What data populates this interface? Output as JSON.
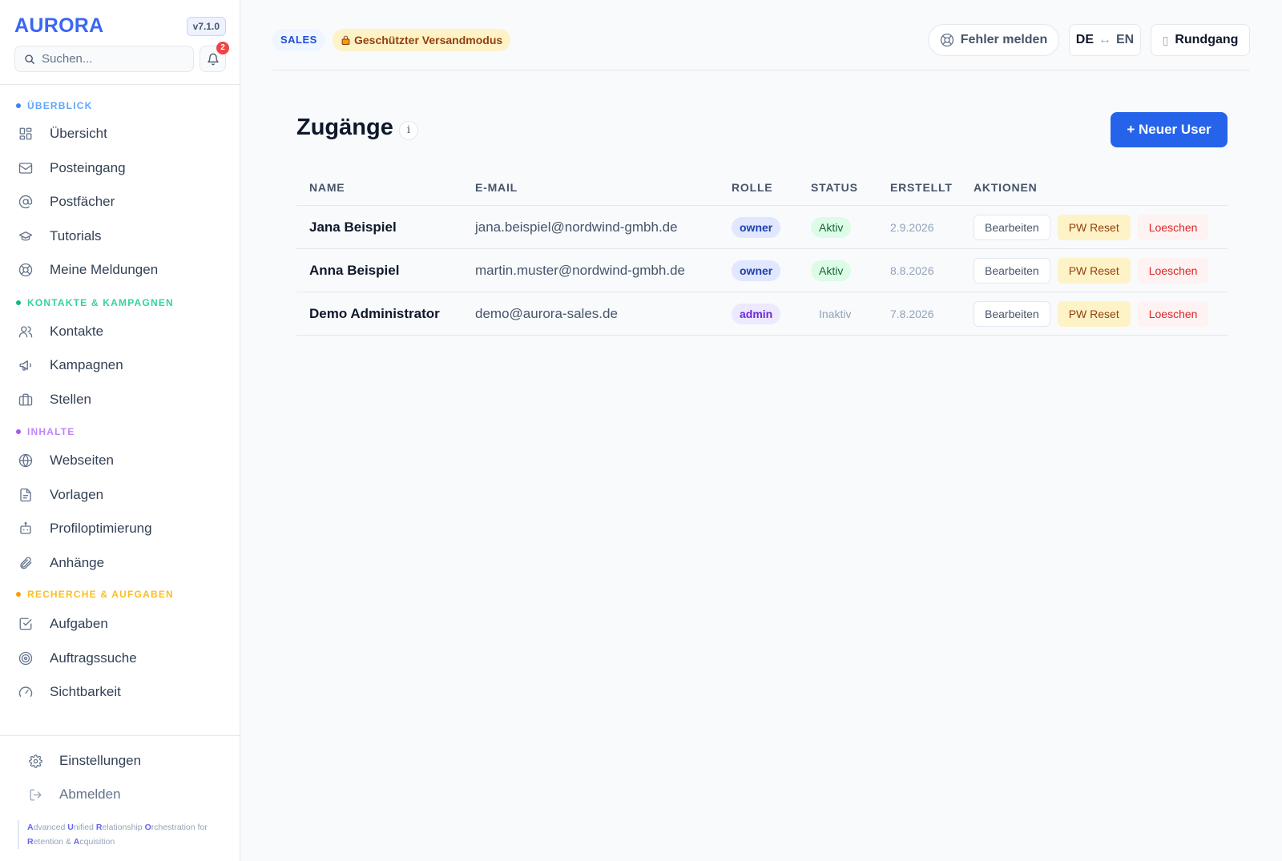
{
  "brand": {
    "name": "AURORA",
    "version": "v7.1.0"
  },
  "search": {
    "placeholder": "Suchen..."
  },
  "notifications": {
    "count": "2"
  },
  "sidebar": {
    "sections": [
      {
        "title": "ÜBERBLICK",
        "color": "#3b82f6",
        "items": [
          "Übersicht",
          "Posteingang",
          "Postfächer",
          "Tutorials",
          "Meine Meldungen"
        ]
      },
      {
        "title": "KONTAKTE & KAMPAGNEN",
        "color": "#10b981",
        "items": [
          "Kontakte",
          "Kampagnen",
          "Stellen"
        ]
      },
      {
        "title": "INHALTE",
        "color": "#a855f7",
        "items": [
          "Webseiten",
          "Vorlagen",
          "Profiloptimierung",
          "Anhänge"
        ]
      },
      {
        "title": "RECHERCHE & AUFGABEN",
        "color": "#f59e0b",
        "items": [
          "Aufgaben",
          "Auftragssuche",
          "Sichtbarkeit"
        ]
      }
    ],
    "bottom": {
      "settings": "Einstellungen",
      "logout": "Abmelden"
    },
    "tagline": {
      "w1a": "A",
      "w1b": "dvanced ",
      "w2a": "U",
      "w2b": "nified ",
      "w3a": "R",
      "w3b": "elationship ",
      "w4a": "O",
      "w4b": "rchestration for",
      "w5a": "R",
      "w5b": "etention & ",
      "w6a": "A",
      "w6b": "cquisition"
    }
  },
  "topbar": {
    "sales_chip": "SALES",
    "protected_chip": "Geschützter Versandmodus",
    "report_button": "Fehler melden",
    "lang_from": "DE",
    "lang_arrow": "↔",
    "lang_to": "EN",
    "tour_glyph": "▯",
    "tour_button": "Rundgang"
  },
  "page": {
    "title": "Zugänge",
    "info": "i",
    "new_user_button": "+ Neuer User"
  },
  "table": {
    "headers": {
      "name": "NAME",
      "email": "E-MAIL",
      "role": "ROLLE",
      "status": "STATUS",
      "created": "ERSTELLT",
      "actions": "AKTIONEN"
    },
    "rows": [
      {
        "name": "Jana Beispiel",
        "email": "jana.beispiel@nordwind-gmbh.de",
        "role": "owner",
        "status": "Aktiv",
        "created": "2.9.2026"
      },
      {
        "name": "Anna Beispiel",
        "email": "martin.muster@nordwind-gmbh.de",
        "role": "owner",
        "status": "Aktiv",
        "created": "8.8.2026"
      },
      {
        "name": "Demo Administrator",
        "email": "demo@aurora-sales.de",
        "role": "admin",
        "status": "Inaktiv",
        "created": "7.8.2026"
      }
    ],
    "actions": {
      "edit": "Bearbeiten",
      "pw_reset": "PW Reset",
      "delete": "Loeschen"
    }
  },
  "colors": {
    "accent": "#2563eb",
    "brand": "#3b66f5"
  }
}
